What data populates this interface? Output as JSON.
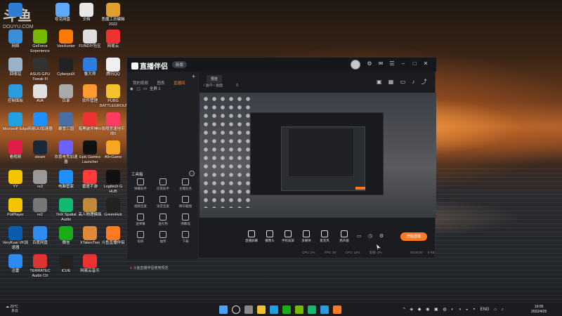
{
  "watermark": {
    "logo": "斗鱼",
    "site": "DOUYU.COM"
  },
  "desktop_icons": [
    {
      "label": "",
      "color": "#2d7dd2"
    },
    {
      "label": "夸克网盘",
      "color": "#5ea8ff"
    },
    {
      "label": "文档",
      "color": "#e8e8e8"
    },
    {
      "label": "恶魔工坊编辑2022",
      "color": "#e0a030"
    },
    {
      "label": "网络",
      "color": "#3b8fd9"
    },
    {
      "label": "GeForce Experience",
      "color": "#76b900"
    },
    {
      "label": "VeeHunter",
      "color": "#ff7a00"
    },
    {
      "label": "FUNDIY社区",
      "color": "#ddd"
    },
    {
      "label": "网易云",
      "color": "#e33"
    },
    {
      "label": "回收站",
      "color": "#9bb3c9"
    },
    {
      "label": "ASUS GPU Tweak III",
      "color": "#333"
    },
    {
      "label": "CyberpulX",
      "color": "#222"
    },
    {
      "label": "鲁大师",
      "color": "#2e7de0"
    },
    {
      "label": "腾讯QQ",
      "color": "#f0f0f0"
    },
    {
      "label": "控制面板",
      "color": "#2b9be0"
    },
    {
      "label": "AVA",
      "color": "#e0e0e0"
    },
    {
      "label": "目录",
      "color": "#aaa"
    },
    {
      "label": "软件管理",
      "color": "#ff9a2e"
    },
    {
      "label": "PUBG BATTLEGROUNDS",
      "color": "#f2c12e"
    },
    {
      "label": "Microsoft Edge",
      "color": "#1fa0e0"
    },
    {
      "label": "网易UU加速器",
      "color": "#1e90ff"
    },
    {
      "label": "暴雪三国",
      "color": "#4a6fa5"
    },
    {
      "label": "暗黑破坏神IV",
      "color": "#e33"
    },
    {
      "label": "极限竞速地平线5",
      "color": "#ff3c64"
    },
    {
      "label": "看视频",
      "color": "#e11d48"
    },
    {
      "label": "steam",
      "color": "#1b2838"
    },
    {
      "label": "欢喜电竞加速器",
      "color": "#6c63ff"
    },
    {
      "label": "Epic Games Launcher",
      "color": "#111"
    },
    {
      "label": "Alt+Game",
      "color": "#f5a623"
    },
    {
      "label": "YY",
      "color": "#f5c400"
    },
    {
      "label": "re3",
      "color": "#999"
    },
    {
      "label": "电脑管家",
      "color": "#1e90ff"
    },
    {
      "label": "雷霆手游",
      "color": "#ff3b3b"
    },
    {
      "label": "Logitech G HUB",
      "color": "#111"
    },
    {
      "label": "PotPlayer",
      "color": "#f5c400"
    },
    {
      "label": "re2",
      "color": "#777"
    },
    {
      "label": "THX Spatial Audio",
      "color": "#14b86e"
    },
    {
      "label": "高人物理模拟",
      "color": "#c08a3a"
    },
    {
      "label": "GreenHub",
      "color": "#222"
    },
    {
      "label": "VeryKuai VK加速器",
      "color": "#0b5cad"
    },
    {
      "label": "百度网盘",
      "color": "#2f8df0"
    },
    {
      "label": "微信",
      "color": "#1aad19"
    },
    {
      "label": "XTakesTwo",
      "color": "#e0883a"
    },
    {
      "label": "斗鱼直播伴侣",
      "color": "#ff7a21"
    },
    {
      "label": "迅雷",
      "color": "#2e8cf0"
    },
    {
      "label": "TERRATEC Audio Ctr",
      "color": "#d33"
    },
    {
      "label": "iCUE",
      "color": "#222"
    },
    {
      "label": "网易云音乐",
      "color": "#e33"
    }
  ],
  "app": {
    "title": "直播伴侣",
    "version": "新版",
    "tabs": [
      "我的视频",
      "图表",
      "直播间"
    ],
    "active_tab_index": 2,
    "scene": "全屏 1",
    "toolbox_title": "工具箱",
    "tools": [
      {
        "label": "弹幕助手",
        "icon": "chat-icon"
      },
      {
        "label": "房管助手",
        "icon": "user-icon"
      },
      {
        "label": "主播任务",
        "icon": "task-icon"
      },
      {
        "label": "视频连麦",
        "icon": "video-icon"
      },
      {
        "label": "语音连麦",
        "icon": "mic-icon"
      },
      {
        "label": "精华截图",
        "icon": "screenshot-icon"
      },
      {
        "label": "送弹幕",
        "icon": "send-icon"
      },
      {
        "label": "送礼物",
        "icon": "gift-icon"
      },
      {
        "label": "弹幕墙",
        "icon": "wall-icon"
      },
      {
        "label": "投屏",
        "icon": "cast-icon"
      },
      {
        "label": "抽奖",
        "icon": "lottery-icon"
      },
      {
        "label": "下载",
        "icon": "download-icon"
      }
    ],
    "bottom_notice": "斗鱼直播伴侣使用规范",
    "preview_tab": "预览",
    "path": [
      "/ 画中 / 画面",
      "0"
    ],
    "controls": [
      {
        "label": "直播屏幕",
        "icon": "monitor-icon"
      },
      {
        "label": "摄像头",
        "icon": "camera-icon"
      },
      {
        "label": "手机投屏",
        "icon": "phone-icon"
      },
      {
        "label": "多媒体",
        "icon": "media-icon"
      },
      {
        "label": "麦克风",
        "icon": "microphone-icon"
      },
      {
        "label": "扬声器",
        "icon": "speaker-icon"
      }
    ],
    "start_button": "开始直播",
    "status": [
      "CPU: 2%",
      "FPS: 30",
      "CPU: 13%",
      "丢帧: 0%"
    ],
    "timer": "00:00:00",
    "bitrate": "0 KB"
  },
  "taskbar": {
    "weather_temp": "29°C",
    "weather_desc": "多云",
    "tray_text": "ENG",
    "time": "19:05",
    "date": "2022/4/25"
  }
}
